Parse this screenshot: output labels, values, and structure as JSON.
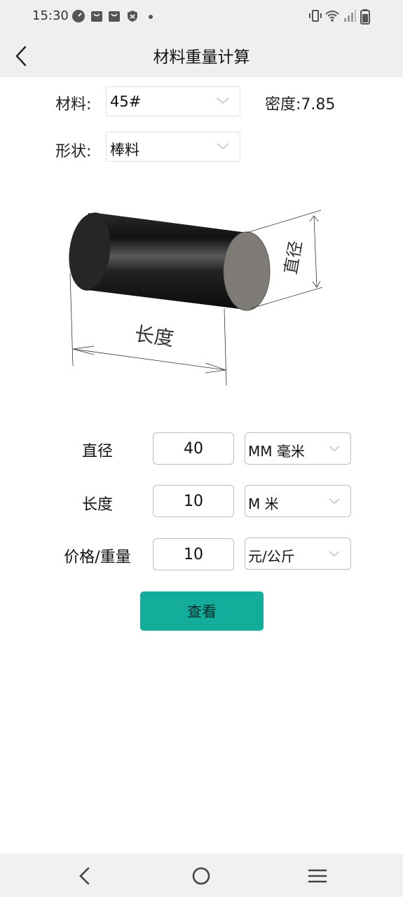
{
  "status_bar": {
    "time": "15:30",
    "left_icons": [
      "speedometer-icon",
      "shopping-bag-icon",
      "shopping-bag-icon",
      "shield-icon",
      "dot-icon"
    ],
    "right_icons": [
      "vibrate-icon",
      "wifi-icon",
      "signal-icon",
      "battery-icon"
    ]
  },
  "app_bar": {
    "title": "材料重量计算",
    "back_icon": "chevron-left-icon"
  },
  "material": {
    "label": "材料:",
    "value": "45#",
    "density_text": "密度:7.85"
  },
  "shape": {
    "label": "形状:",
    "value": "棒料"
  },
  "illustration": {
    "length_label": "长度",
    "diameter_label": "直径"
  },
  "rows": [
    {
      "label": "直径",
      "value": "40",
      "unit": "MM 毫米"
    },
    {
      "label": "长度",
      "value": "10",
      "unit": "M 米"
    },
    {
      "label": "价格/重量",
      "value": "10",
      "unit": "元/公斤"
    }
  ],
  "action": {
    "view_label": "查看"
  },
  "colors": {
    "accent": "#14ad9c",
    "bar_bg": "#efefef"
  },
  "nav_bar": {
    "icons": [
      "back-icon",
      "home-icon",
      "menu-icon"
    ]
  }
}
